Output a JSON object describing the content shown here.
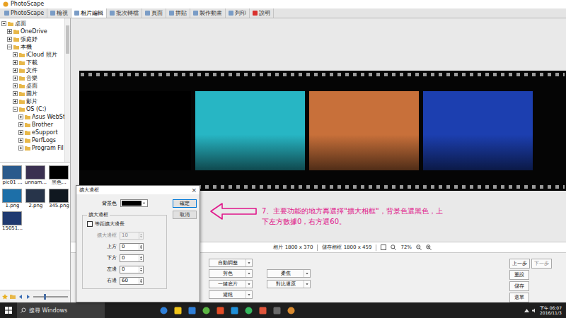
{
  "window": {
    "title": "PhotoScape"
  },
  "tabs": [
    {
      "label": "PhotoScape",
      "selected": false
    },
    {
      "label": "檢視",
      "selected": false
    },
    {
      "label": "相片編輯",
      "selected": true
    },
    {
      "label": "批次轉檔",
      "selected": false
    },
    {
      "label": "頁面",
      "selected": false
    },
    {
      "label": "拼貼",
      "selected": false
    },
    {
      "label": "製作動畫",
      "selected": false
    },
    {
      "label": "列印",
      "selected": false
    },
    {
      "label": "說明",
      "selected": false
    }
  ],
  "tree": [
    {
      "label": "桌面",
      "expanded": true,
      "children": [
        {
          "label": "OneDrive",
          "expanded": false
        },
        {
          "label": "張庭妤",
          "expanded": false
        },
        {
          "label": "本機",
          "expanded": true,
          "children": [
            {
              "label": "iCloud 照片",
              "expanded": false
            },
            {
              "label": "下載",
              "expanded": false
            },
            {
              "label": "文件",
              "expanded": false
            },
            {
              "label": "音樂",
              "expanded": false
            },
            {
              "label": "桌面",
              "expanded": false
            },
            {
              "label": "圖片",
              "expanded": false
            },
            {
              "label": "影片",
              "expanded": false
            },
            {
              "label": "OS (C:)",
              "expanded": true,
              "children": [
                {
                  "label": "Asus WebSt",
                  "expanded": false
                },
                {
                  "label": "Brother",
                  "expanded": false
                },
                {
                  "label": "eSupport",
                  "expanded": false
                },
                {
                  "label": "PerfLogs",
                  "expanded": false
                },
                {
                  "label": "Program Fil",
                  "expanded": false
                }
              ]
            }
          ]
        }
      ]
    }
  ],
  "thumbnails": [
    {
      "label": "pic01 ...",
      "selected": false,
      "color": "#2a5a8c"
    },
    {
      "label": "unnam...",
      "selected": false,
      "color": "#3a3050"
    },
    {
      "label": "黑色...",
      "selected": false,
      "color": "#000000"
    },
    {
      "label": "1.png",
      "selected": false,
      "color": "#1d6fa8"
    },
    {
      "label": "2.png",
      "selected": false,
      "color": "#27344a"
    },
    {
      "label": "345.png",
      "selected": false,
      "color": "#101820"
    },
    {
      "label": "15051...",
      "selected": false,
      "color": "#203a70"
    }
  ],
  "filmstrip": {
    "frames": [
      {
        "color": "#000000"
      },
      {
        "color": "#27b6c4"
      },
      {
        "color": "#c8703a"
      },
      {
        "color": "#1c3fb0"
      }
    ]
  },
  "info_bar": {
    "photo": "相片 1800 x 370",
    "saved": "儲存相框 1800 x 459",
    "zoom": "72%"
  },
  "controls": {
    "columns": [
      [
        "自動調整",
        "剪色",
        "一鍵底片",
        "濾鏡"
      ],
      [
        "柔焦",
        "對比還原"
      ]
    ]
  },
  "history_buttons": [
    {
      "label": "上一步",
      "disabled": false
    },
    {
      "label": "下一步",
      "disabled": true
    },
    {
      "label": "重設",
      "disabled": false
    },
    {
      "label": "儲存",
      "disabled": false
    },
    {
      "label": "選單",
      "disabled": false
    }
  ],
  "dialog": {
    "title": "擴大邊框",
    "close": "×",
    "background_label": "背景色",
    "background_color": "#000000",
    "buttons": [
      {
        "label": "確定",
        "selected": true
      },
      {
        "label": "取消",
        "selected": false
      }
    ],
    "group": "擴大邊框",
    "checkbox": {
      "label": "等距擴大邊長",
      "checked": false
    },
    "fields": [
      {
        "label": "擴大邊框",
        "value": "10",
        "disabled": true
      },
      {
        "label": "上方",
        "value": "0",
        "disabled": false
      },
      {
        "label": "下方",
        "value": "0",
        "disabled": false
      },
      {
        "label": "左邊",
        "value": "0",
        "disabled": false
      },
      {
        "label": "右邊",
        "value": "60",
        "disabled": false
      }
    ]
  },
  "annotation": {
    "text": "7、主要功能的地方再選擇\"擴大相框\"，背景色選黑色，上下左方數據0，右方選60。"
  },
  "taskbar": {
    "search": "搜尋 Windows",
    "time": "下午 06:07",
    "date": "2016/11/3"
  }
}
